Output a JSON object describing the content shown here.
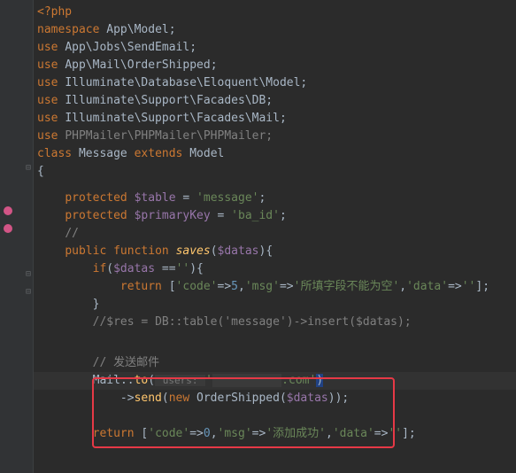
{
  "lines": {
    "l1": {
      "open": "<?php"
    },
    "l2": {
      "ns": "namespace",
      "path": "App\\Model",
      "semi": ";"
    },
    "l3": {
      "use": "use",
      "path": "App\\Jobs\\SendEmail",
      "semi": ";"
    },
    "l4": {
      "use": "use",
      "path": "App\\Mail\\OrderShipped",
      "semi": ";"
    },
    "l5": {
      "use": "use",
      "path": "Illuminate\\Database\\Eloquent\\Model",
      "semi": ";"
    },
    "l6": {
      "use": "use",
      "path": "Illuminate\\Support\\Facades\\DB",
      "semi": ";"
    },
    "l7": {
      "use": "use",
      "path": "Illuminate\\Support\\Facades\\Mail",
      "semi": ";"
    },
    "l8": {
      "use": "use",
      "path": "PHPMailer\\PHPMailer\\PHPMailer",
      "semi": ";"
    },
    "l9": {
      "class": "class",
      "name": "Message",
      "extends": "extends",
      "parent": "Model"
    },
    "l10": {
      "brace": "{"
    },
    "l11": {
      "prot": "protected",
      "var": "$table",
      "eq": " = ",
      "val": "'message'",
      "semi": ";"
    },
    "l12": {
      "prot": "protected",
      "var": "$primaryKey",
      "eq": " = ",
      "val": "'ba_id'",
      "semi": ";"
    },
    "l13": {
      "cmt": "//"
    },
    "l14": {
      "pub": "public",
      "func": "function",
      "name": "saves",
      "open": "(",
      "param": "$datas",
      "close": "){"
    },
    "l15": {
      "if": "if",
      "open": "(",
      "var": "$datas",
      "op": " ==",
      "val": "''",
      "close": "){"
    },
    "l16": {
      "ret": "return",
      "open": " [",
      "k1": "'code'",
      "a1": "=>",
      "v1": "5",
      "c1": ",",
      "k2": "'msg'",
      "a2": "=>",
      "v2": "'所填字段不能为空'",
      "c2": ",",
      "k3": "'data'",
      "a3": "=>",
      "v3": "''",
      "close": "];"
    },
    "l17": {
      "brace": "}"
    },
    "l18": {
      "cmt": "//$res = DB::table('message')->insert($datas);"
    },
    "l19": {
      "cmt": "// 发送邮件"
    },
    "l20": {
      "cls": "Mail",
      "op": "::",
      "fn": "to",
      "open": "(",
      "hint": " users: ",
      "str": "'",
      "redact": "          ",
      "str2": ".com'",
      "close": ")"
    },
    "l21": {
      "arrow": "->",
      "fn": "send",
      "open": "(",
      "new": "new",
      "cls": " OrderShipped",
      "open2": "(",
      "var": "$datas",
      "close": "));"
    },
    "l22": {
      "ret": "return",
      "open": " [",
      "k1": "'code'",
      "a1": "=>",
      "v1": "0",
      "c1": ",",
      "k2": "'msg'",
      "a2": "=>",
      "v2": "'添加成功'",
      "c2": ",",
      "k3": "'data'",
      "a3": "=>",
      "v3": "''",
      "close": "];"
    }
  }
}
